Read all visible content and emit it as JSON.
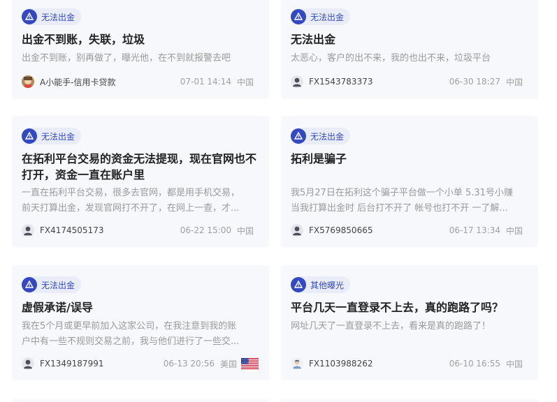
{
  "posts": [
    {
      "tag": "无法出金",
      "title": "出金不到账，失联，垃圾",
      "desc": [
        "出金不到账，别再做了，曝光他，在不到就报警去吧"
      ],
      "user": "A小能手-信用卡贷款",
      "avatar": "photo-avatar",
      "time": "07-01 14:14",
      "region": "中国"
    },
    {
      "tag": "无法出金",
      "title": "无法出金",
      "desc": [
        "太恶心，客户的出不来，我的也出不来，垃圾平台"
      ],
      "user": "FX1543783373",
      "avatar": "user-icon",
      "time": "06-30 18:27",
      "region": "中国"
    },
    {
      "tag": "无法出金",
      "title": [
        "在拓利平台交易的资金无法提现，现在官网也不",
        "打开，资金一直在账户里"
      ],
      "desc": [
        "一直在拓利平台交易，很多去官网，都是用手机交易，",
        "前天打算出金，发现官网打不开了，在网上一查，才..."
      ],
      "user": "FX4174505173",
      "avatar": "user-icon",
      "time": "06-22 15:00",
      "region": "中国"
    },
    {
      "tag": "无法出金",
      "title": "拓利是骗子",
      "desc": [
        "我5月27日在拓利这个骗子平台做一个小单 5.31号小赚",
        "当我打算出金时 后台打不开了 帐号也打不开 一了解..."
      ],
      "user": "FX5769850665",
      "avatar": "user-icon",
      "time": "06-17 13:34",
      "region": "中国"
    },
    {
      "tag": "无法出金",
      "title": "虚假承诺/误导",
      "desc": [
        "我在5个月或更早前加入这家公司，在我注意到我的账",
        "户中有一些不规则交易之前，我与他们进行了一些交..."
      ],
      "user": "FX1349187991",
      "avatar": "user-icon",
      "time": "06-13 20:56",
      "region": "美国",
      "flag": "us-flag"
    },
    {
      "tag": "其他曝光",
      "title": "平台几天一直登录不上去，真的跑路了吗？",
      "desc": [
        "网址几天了一直登录不上去，看来是真的跑路了！"
      ],
      "user": "FX1103988262",
      "avatar": "user-icon-light",
      "time": "06-10 16:55",
      "region": "中国"
    }
  ],
  "colors": {
    "accent": "#3349c2",
    "badge_bg": "#e9ecf9",
    "card_bg": "#f7f8fb"
  }
}
